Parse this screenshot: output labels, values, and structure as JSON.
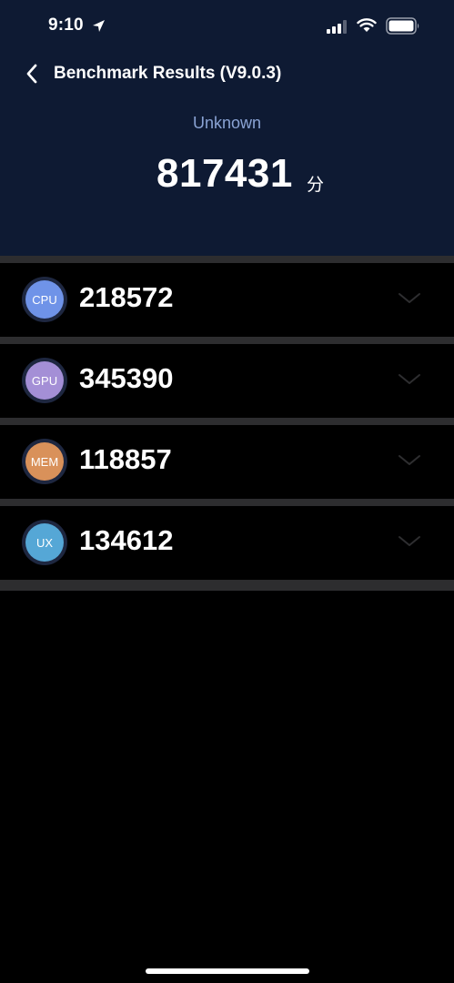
{
  "status_bar": {
    "time": "9:10"
  },
  "nav": {
    "title": "Benchmark Results (V9.0.3)"
  },
  "summary": {
    "device_name": "Unknown",
    "total_score": "817431",
    "unit": "分"
  },
  "scores": [
    {
      "label": "CPU",
      "value": "218572",
      "color": "#6f93e8"
    },
    {
      "label": "GPU",
      "value": "345390",
      "color": "#a48fd6"
    },
    {
      "label": "MEM",
      "value": "118857",
      "color": "#d9915a"
    },
    {
      "label": "UX",
      "value": "134612",
      "color": "#55a7d6"
    }
  ],
  "colors": {
    "header_bg": "#0e1a33",
    "page_bg": "#000000",
    "divider": "#2d2d2f",
    "device_name": "#8aa3d4"
  }
}
